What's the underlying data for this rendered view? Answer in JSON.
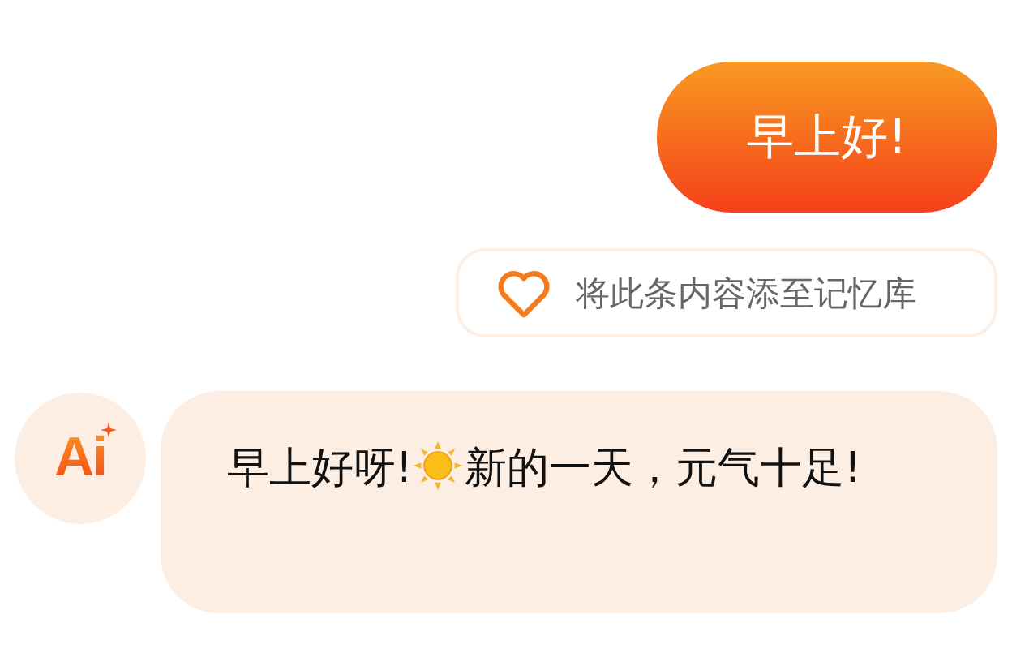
{
  "messages": [
    {
      "kind": "user",
      "text": "早上好!"
    },
    {
      "kind": "action",
      "label": "将此条内容添至记忆库"
    },
    {
      "kind": "assistant",
      "avatar": "Ai",
      "parts": [
        "早上好呀!",
        "新的一天，元气十足!"
      ]
    }
  ]
}
